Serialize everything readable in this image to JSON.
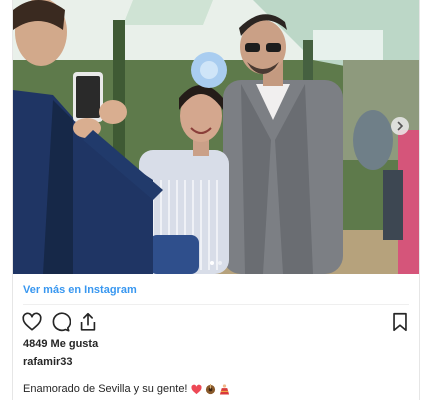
{
  "post": {
    "view_more_link": "Ver más en Instagram",
    "likes_text": "4849 Me gusta",
    "username": "rafamir33",
    "caption_text": "Enamorado de Sevilla y su gente!",
    "caption_emojis": [
      "heart",
      "flamenco-guitar",
      "flamenco-dancer"
    ],
    "photo_carousel": {
      "slide_count": 2,
      "active_slide": 1
    }
  },
  "icons": {
    "like": "heart-icon",
    "comment": "comment-icon",
    "share": "share-icon",
    "save": "bookmark-icon",
    "next": "chevron-right-icon"
  },
  "colors": {
    "link": "#3897f0",
    "text": "#262626",
    "heart_emoji": "#ed4956"
  }
}
